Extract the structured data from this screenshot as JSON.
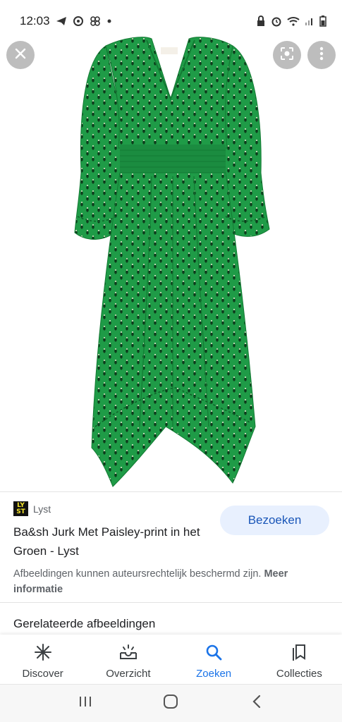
{
  "status_bar": {
    "time": "12:03",
    "left_icons": [
      "telegram-icon",
      "whatsapp-icon",
      "fan-icon",
      "dot-icon"
    ],
    "right_icons": [
      "lock-icon",
      "alarm-icon",
      "wifi-icon",
      "signal-icon",
      "battery-icon"
    ]
  },
  "hero": {
    "dress_label": "ba&sh",
    "image_colors": {
      "dress": "#1e9a45",
      "dress_dark": "#137a33",
      "dots": "#0d3d1c",
      "sparkle": "#e8e4c8"
    }
  },
  "controls": {
    "close_icon": "close-icon",
    "lens_icon": "lens-icon",
    "more_icon": "more-vert-icon"
  },
  "result": {
    "source_logo_line1": "LY",
    "source_logo_line2": "ST",
    "source_name": "Lyst",
    "title": "Ba&sh Jurk Met Paisley-print in het Groen - Lyst",
    "visit_label": "Bezoeken",
    "copyright_text": "Afbeeldingen kunnen auteursrechtelijk beschermd zijn.",
    "more_info_label": "Meer informatie",
    "related_heading": "Gerelateerde afbeeldingen"
  },
  "bottom_nav": {
    "items": [
      {
        "label": "Discover",
        "icon": "asterisk-icon",
        "active": false
      },
      {
        "label": "Overzicht",
        "icon": "overview-icon",
        "active": false
      },
      {
        "label": "Zoeken",
        "icon": "search-icon",
        "active": true
      },
      {
        "label": "Collecties",
        "icon": "collections-icon",
        "active": false
      }
    ]
  },
  "system_nav": [
    "recent-apps-icon",
    "home-icon",
    "back-icon"
  ],
  "colors": {
    "accent": "#1a73e8",
    "visit_bg": "#e8f0fe",
    "visit_text": "#1a56b8"
  }
}
